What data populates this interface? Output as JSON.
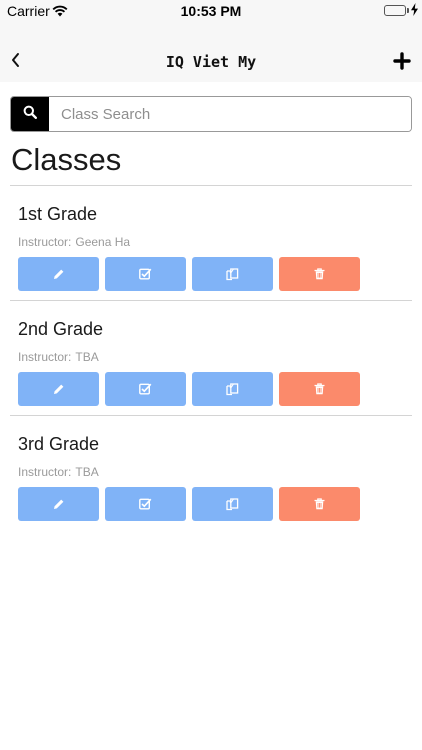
{
  "status_bar": {
    "carrier": "Carrier",
    "time": "10:53 PM",
    "icons": [
      "wifi-icon",
      "battery-icon",
      "charging-icon"
    ],
    "battery_color": "#4cd964"
  },
  "nav": {
    "title": "IQ Viet My",
    "back_icon": "chevron-left-icon",
    "add_icon": "plus-icon"
  },
  "search": {
    "placeholder": "Class Search",
    "value": "",
    "icon": "search-icon"
  },
  "section_title": "Classes",
  "classes": [
    {
      "name": "1st Grade",
      "instructor_label": "Instructor:",
      "instructor": "Geena Ha"
    },
    {
      "name": "2nd Grade",
      "instructor_label": "Instructor:",
      "instructor": "TBA"
    },
    {
      "name": "3rd Grade",
      "instructor_label": "Instructor:",
      "instructor": "TBA"
    }
  ],
  "actions": [
    {
      "icon": "pencil-icon",
      "color": "#80b3f7"
    },
    {
      "icon": "checkbox-icon",
      "color": "#80b3f7"
    },
    {
      "icon": "copy-icon",
      "color": "#80b3f7"
    },
    {
      "icon": "trash-icon",
      "color": "#fb8a6b"
    }
  ]
}
